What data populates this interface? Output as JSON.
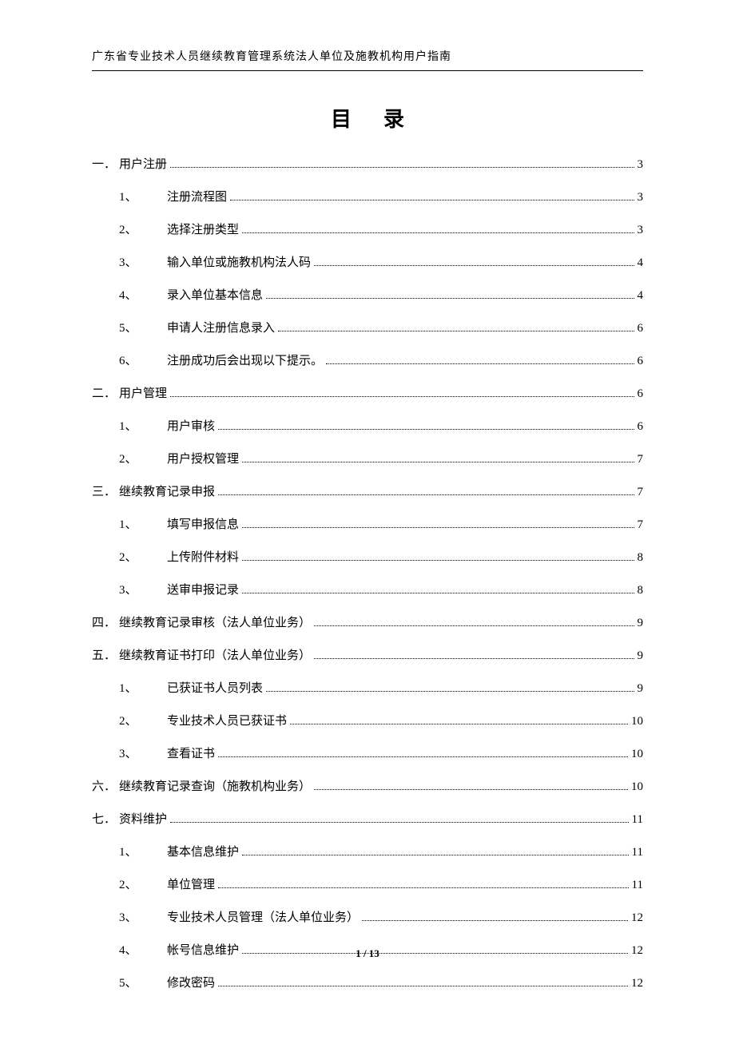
{
  "header": "广东省专业技术人员继续教育管理系统法人单位及施教机构用户指南",
  "title_a": "目",
  "title_b": "录",
  "footer": "1 / 13",
  "toc": [
    {
      "level": 1,
      "num": "一．",
      "label": "用户注册",
      "page": "3"
    },
    {
      "level": 2,
      "num": "1、",
      "label": "注册流程图",
      "page": "3"
    },
    {
      "level": 2,
      "num": "2、",
      "label": "选择注册类型",
      "page": "3"
    },
    {
      "level": 2,
      "num": "3、",
      "label": "输入单位或施教机构法人码",
      "page": "4"
    },
    {
      "level": 2,
      "num": "4、",
      "label": "录入单位基本信息",
      "page": "4"
    },
    {
      "level": 2,
      "num": "5、",
      "label": "申请人注册信息录入",
      "page": "6"
    },
    {
      "level": 2,
      "num": "6、",
      "label": "注册成功后会出现以下提示。",
      "page": "6"
    },
    {
      "level": 1,
      "num": "二．",
      "label": "用户管理",
      "page": "6"
    },
    {
      "level": 2,
      "num": "1、",
      "label": "用户审核",
      "page": "6"
    },
    {
      "level": 2,
      "num": "2、",
      "label": "用户授权管理",
      "page": "7"
    },
    {
      "level": 1,
      "num": "三．",
      "label": "继续教育记录申报",
      "page": "7"
    },
    {
      "level": 2,
      "num": "1、",
      "label": "填写申报信息",
      "page": "7"
    },
    {
      "level": 2,
      "num": "2、",
      "label": "上传附件材料",
      "page": "8"
    },
    {
      "level": 2,
      "num": "3、",
      "label": "送审申报记录",
      "page": "8"
    },
    {
      "level": 1,
      "num": "四．",
      "label": "继续教育记录审核（法人单位业务）",
      "page": "9"
    },
    {
      "level": 1,
      "num": "五．",
      "label": "继续教育证书打印（法人单位业务）",
      "page": "9"
    },
    {
      "level": 2,
      "num": "1、",
      "label": "已获证书人员列表",
      "page": "9"
    },
    {
      "level": 2,
      "num": "2、",
      "label": "专业技术人员已获证书",
      "page": "10"
    },
    {
      "level": 2,
      "num": "3、",
      "label": "查看证书",
      "page": "10"
    },
    {
      "level": 1,
      "num": "六．",
      "label": "继续教育记录查询（施教机构业务）",
      "page": "10"
    },
    {
      "level": 1,
      "num": "七．",
      "label": "资料维护",
      "page": "11"
    },
    {
      "level": 2,
      "num": "1、",
      "label": "基本信息维护",
      "page": "11"
    },
    {
      "level": 2,
      "num": "2、",
      "label": "单位管理",
      "page": "11"
    },
    {
      "level": 2,
      "num": "3、",
      "label": "专业技术人员管理（法人单位业务）",
      "page": "12"
    },
    {
      "level": 2,
      "num": "4、",
      "label": "帐号信息维护",
      "page": "12"
    },
    {
      "level": 2,
      "num": "5、",
      "label": "修改密码",
      "page": "12"
    }
  ]
}
